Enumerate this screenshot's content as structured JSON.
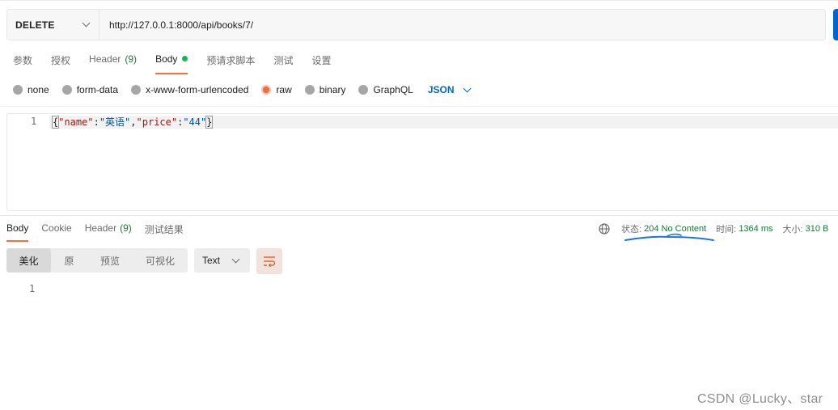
{
  "request": {
    "method": "DELETE",
    "url": "http://127.0.0.1:8000/api/books/7/"
  },
  "request_tabs": [
    {
      "label": "参数"
    },
    {
      "label": "授权"
    },
    {
      "label": "Header",
      "count": "(9)"
    },
    {
      "label": "Body",
      "active": true
    },
    {
      "label": "预请求脚本"
    },
    {
      "label": "测试"
    },
    {
      "label": "设置"
    }
  ],
  "body_types": [
    {
      "label": "none"
    },
    {
      "label": "form-data"
    },
    {
      "label": "x-www-form-urlencoded"
    },
    {
      "label": "raw",
      "selected": true
    },
    {
      "label": "binary"
    },
    {
      "label": "GraphQL"
    }
  ],
  "body_format": "JSON",
  "editor": {
    "line_number": "1",
    "tokens": {
      "open": "{",
      "k1": "\"name\"",
      "colon": ":",
      "v1": "\"英语\"",
      "comma": ",",
      "k2": "\"price\"",
      "v2": "\"44\"",
      "close": "}"
    }
  },
  "response_tabs": [
    {
      "label": "Body",
      "active": true
    },
    {
      "label": "Cookie"
    },
    {
      "label": "Header",
      "count": "(9)"
    },
    {
      "label": "测试结果"
    }
  ],
  "response_status": {
    "status_label": "状态:",
    "status_value": "204 No Content",
    "time_label": "时间:",
    "time_value": "1364 ms",
    "size_label": "大小:",
    "size_value": "310 B"
  },
  "view_buttons": [
    {
      "label": "美化",
      "active": true
    },
    {
      "label": "原"
    },
    {
      "label": "预览"
    },
    {
      "label": "可视化"
    }
  ],
  "response_format": "Text",
  "response_line_number": "1",
  "watermark": "CSDN @Lucky、star",
  "colors": {
    "accent_tab": "#ff6c37",
    "status_green": "#0c7e3b",
    "link_blue": "#0265d2",
    "annotation_blue": "#1a73e8"
  }
}
